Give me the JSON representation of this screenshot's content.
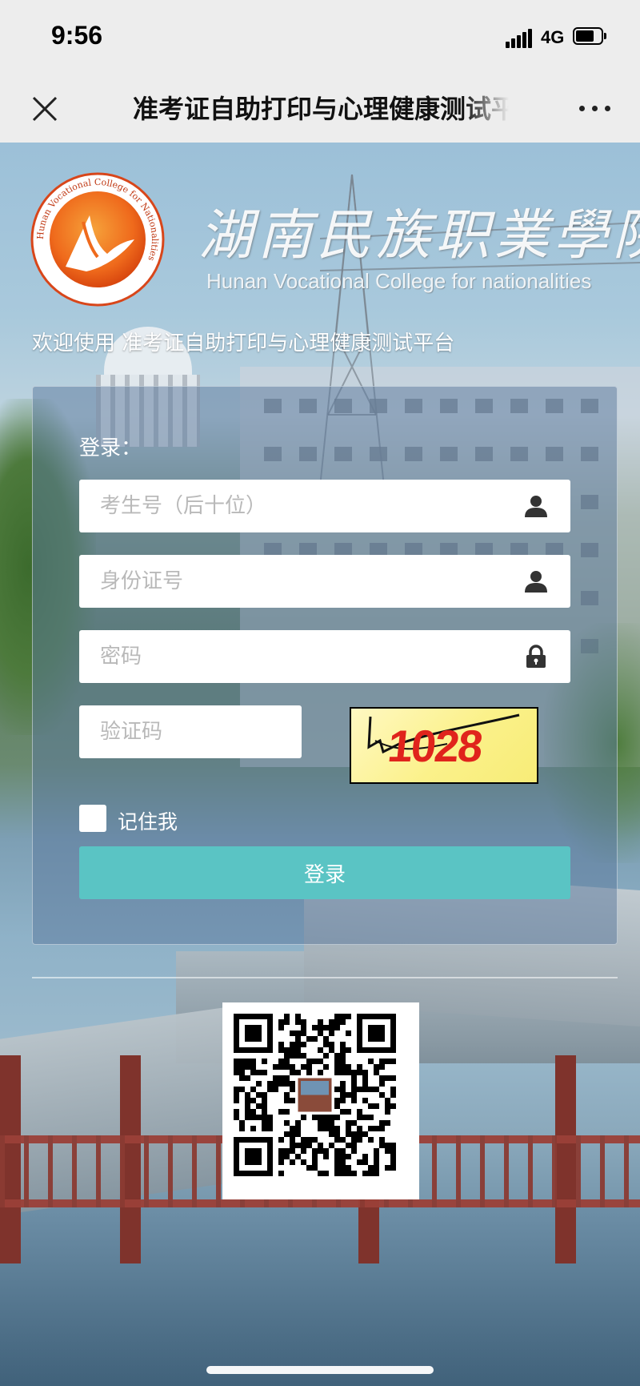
{
  "status_bar": {
    "time": "9:56",
    "network": "4G"
  },
  "header": {
    "title": "准考证自助打印与心理健康测试平台"
  },
  "college": {
    "name_cn": "湖南民族职業學院",
    "name_en": "Hunan Vocational College for nationalities",
    "logo_text": "Hunan Vocational College for Nationalities",
    "logo_text_cn": "湖南民族职业学院"
  },
  "welcome_text": "欢迎使用 准考证自助打印与心理健康测试平台",
  "login": {
    "title": "登录：",
    "exam_no_placeholder": "考生号（后十位）",
    "id_card_placeholder": "身份证号",
    "password_placeholder": "密码",
    "captcha_placeholder": "验证码",
    "captcha_text": "1028",
    "remember_label": "记住我",
    "submit_label": "登录"
  },
  "icons": {
    "close": "close-icon",
    "more": "more-dots-icon",
    "user": "user-icon",
    "lock": "lock-icon",
    "qr": "qr-code"
  },
  "colors": {
    "accent": "#5ac4c4",
    "captcha_text": "#e0241c",
    "logo_orange": "#ef6a1c"
  }
}
